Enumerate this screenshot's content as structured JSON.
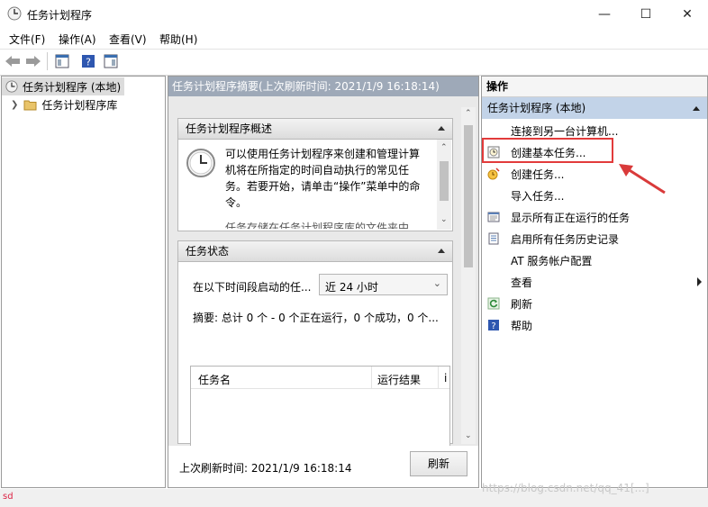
{
  "window": {
    "title": "任务计划程序"
  },
  "menu": [
    "文件(F)",
    "操作(A)",
    "查看(V)",
    "帮助(H)"
  ],
  "tree": {
    "root_label": "任务计划程序 (本地)",
    "child_label": "任务计划程序库"
  },
  "middle": {
    "header": "任务计划程序摘要(上次刷新时间: 2021/1/9 16:18:14)",
    "overview": {
      "title": "任务计划程序概述",
      "text": "可以使用任务计划程序来创建和管理计算机将在所指定的时间自动执行的常见任务。若要开始，请单击“操作”菜单中的命令。",
      "text2": "任务存储在任务计划程序库的文件夹中"
    },
    "status": {
      "title": "任务状态",
      "filter_label": "在以下时间段启动的任...",
      "filter_value": "近 24 小时",
      "summary": "摘要: 总计 0 个 - 0 个正在运行，0 个成功，0 个...",
      "col_task": "任务名",
      "col_result": "运行结果",
      "col_extra": "i"
    },
    "footer": {
      "last_refresh": "上次刷新时间: 2021/1/9 16:18:14",
      "refresh_button": "刷新"
    }
  },
  "actions": {
    "title": "操作",
    "group": "任务计划程序 (本地)",
    "items": [
      {
        "label": "连接到另一台计算机...",
        "icon": "none"
      },
      {
        "label": "创建基本任务...",
        "icon": "basic-task-icon"
      },
      {
        "label": "创建任务...",
        "icon": "create-task-icon"
      },
      {
        "label": "导入任务...",
        "icon": "none"
      },
      {
        "label": "显示所有正在运行的任务",
        "icon": "running-tasks-icon"
      },
      {
        "label": "启用所有任务历史记录",
        "icon": "history-icon"
      },
      {
        "label": "AT 服务帐户配置",
        "icon": "none"
      },
      {
        "label": "查看",
        "icon": "none"
      },
      {
        "label": "刷新",
        "icon": "refresh-icon"
      },
      {
        "label": "帮助",
        "icon": "help-icon"
      }
    ]
  },
  "statusbar": {
    "text": "sd"
  },
  "watermark": "https://blog.csdn.net/qq_41[...]"
}
